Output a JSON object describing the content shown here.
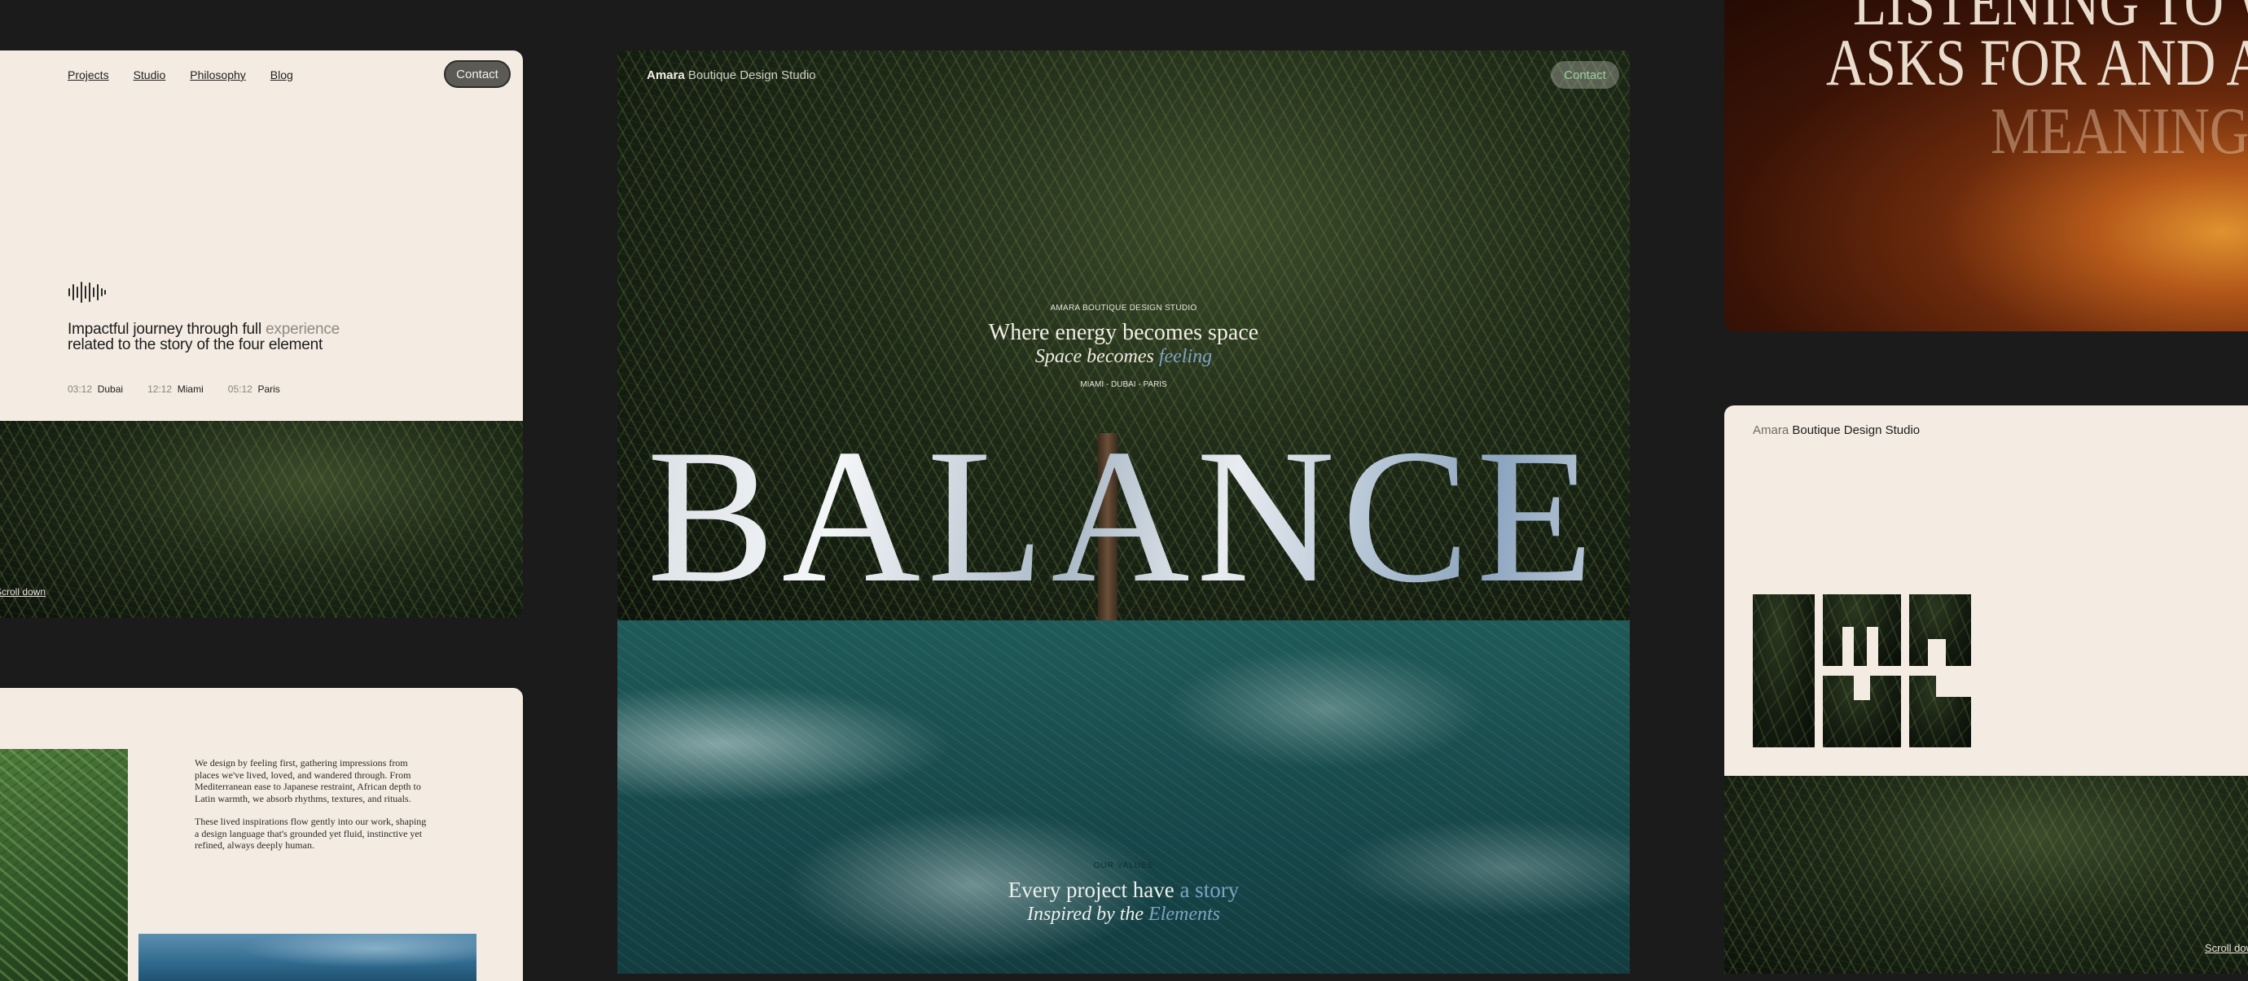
{
  "card_top_left": {
    "nav": [
      "Projects",
      "Studio",
      "Philosophy",
      "Blog"
    ],
    "contact_label": "Contact",
    "headline_main": "Impactful journey through full",
    "headline_muted": "experience",
    "headline_line2": "related to the story of the four element",
    "times": [
      {
        "time": "03:12",
        "city": "Dubai"
      },
      {
        "time": "12:12",
        "city": "Miami"
      },
      {
        "time": "05:12",
        "city": "Paris"
      }
    ],
    "scroll_label": "Scroll down"
  },
  "card_bottom_left": {
    "para1": "We design by feeling first, gathering impressions from places we've lived, loved, and wandered through. From Mediterranean ease to Japanese restraint, African depth to Latin warmth, we absorb rhythms, textures, and rituals.",
    "para2": "These lived inspirations flow gently into our work, shaping a design language that's grounded yet fluid, instinctive yet refined, always deeply human."
  },
  "card_center": {
    "brand_bold": "Amara",
    "brand_rest": "Boutique Design Studio",
    "contact_label": "Contact",
    "eyebrow": "AMARA BOUTIQUE DESIGN STUDIO",
    "tagline1": "Where energy becomes space",
    "tagline2a": "Space becomes",
    "tagline2b": "feeling",
    "cities": "MIAMI - DUBAI - PARIS",
    "hero_word": "BALANCE",
    "ocean_eyebrow": "OUR VALUES",
    "ocean_line1a": "Every project have",
    "ocean_line1b": "a story",
    "ocean_line2a": "Inspired by the",
    "ocean_line2b": "Elements"
  },
  "card_top_right": {
    "line1": "LISTENING TO W",
    "line2": "ASKS FOR AND AN",
    "line3": "MEANING A"
  },
  "card_right": {
    "brand_light": "Amara",
    "brand_rest": "Boutique Design Studio",
    "scroll_label": "Scroll dow"
  },
  "colors": {
    "bg": "#1b1b1b",
    "cream": "#f4ece2",
    "accent_blue": "#7fa3c4",
    "contact_green": "#9fd1a0"
  }
}
